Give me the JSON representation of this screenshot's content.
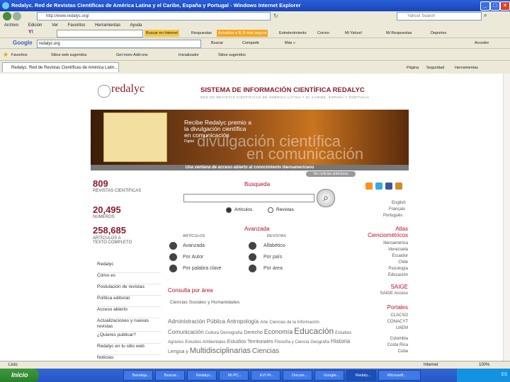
{
  "window": {
    "title": "Redalyc. Red de Revistas Científicas de América Latina y el Caribe, España y Portugal - Windows Internet Explorer",
    "controls": [
      "_",
      "□",
      "×"
    ]
  },
  "address_bar": {
    "url": "http://www.redalyc.org/",
    "search_placeholder": "Yahoo! Search"
  },
  "menu": [
    "Archivo",
    "Edición",
    "Ver",
    "Favoritos",
    "Herramientas",
    "Ayuda"
  ],
  "toolbar1": {
    "items": [
      "Buscar en Internet",
      "Respuestas",
      "Actualiza a IE 8 más segura",
      "Entretenimiento",
      "Correo",
      "Noticias",
      "Mi Yahoo!",
      "Mi Respuestas",
      "Deportes"
    ]
  },
  "google_bar": {
    "label": "Google",
    "query": "redalyc.org",
    "buttons": [
      "Buscar",
      "Compartir",
      "Más »"
    ],
    "right": "Acceder"
  },
  "favorites_bar": {
    "items": [
      "Favoritos",
      "Sitios web sugeridos",
      "Get more Add-ons",
      "Inicializador",
      "Sitios sugeridos"
    ],
    "tools": [
      "Página",
      "Seguridad",
      "Herramientas"
    ]
  },
  "tab": {
    "label": "Redalyc. Red de Revistas Científicas de América Latin..."
  },
  "site": {
    "logo": "redalyc",
    "title": "SISTEMA DE INFORMACIÓN CIENTÍFICA REDALYC",
    "subtitle": "RED DE REVISTAS CIENTÍFICAS DE AMÉRICA LATINA Y EL CARIBE, ESPAÑA Y PORTUGAL",
    "banner": {
      "headline_line1": "Recibe Redalyc premio a",
      "headline_line2": "la divulgación científica",
      "headline_line3": "en comunicación",
      "headline_line4": "Digital",
      "overlay_line1": "divulgación científica",
      "overlay_line2": "en comunicación",
      "slogan": "Una ventana de acceso abierto al conocimiento iberoamericano",
      "more_button": "Ver noticias anteriores"
    },
    "stats": [
      {
        "value": "809",
        "label": "REVISTAS CIENTÍFICAS"
      },
      {
        "value": "20,495",
        "label": "NÚMEROS"
      },
      {
        "value": "258,685",
        "label": "ARTÍCULOS A TEXTO COMPLETO"
      }
    ],
    "search": {
      "title": "Busqueda",
      "input_value": "",
      "option_articles": "Artículos",
      "option_journals": "Revistas"
    },
    "advanced": {
      "title": "Avanzada",
      "col_articles": "ARTÍCULOS",
      "col_journals": "REVISTAS",
      "articles": [
        "Avanzada",
        "Por Autor",
        "Por palabra clave"
      ],
      "journals": [
        "Alfabético",
        "Por país",
        "Por área"
      ]
    },
    "nav": [
      "Redalyc",
      "Cómo es",
      "Postulación de revistas",
      "Política editorial",
      "Acceso abierto",
      "Actualizaciones y nuevas revistas",
      "¿Quieres publicar?",
      "Redalyc en tu sitio web",
      "Noticias"
    ],
    "area": {
      "title": "Consulta por área",
      "category": "Ciencias Sociales y Humanidades",
      "cloud": [
        "Administración Pública",
        "Antropología",
        "Arte",
        "Ciencias de la Información",
        "Comunicación",
        "Cultura",
        "Demografía",
        "Derecho",
        "Economía",
        "Educación",
        "Estudios Agrarios",
        "Estudios Ambientales",
        "Estudios Territoriales",
        "Filosofía y Ciencia",
        "Geografía",
        "Historia",
        "Lengua y",
        "Multidisciplinarias",
        "Ciencias"
      ]
    },
    "languages": [
      "English",
      "Français",
      "Português"
    ],
    "atlas": {
      "title": "Atlas Cienciométricos",
      "items": [
        "Iberoamérica",
        "Venezuela",
        "Ecuador",
        "Chile",
        "Psicología",
        "Educación"
      ]
    },
    "saige": {
      "title": "SAIGE",
      "link": "SAIGE Acceso"
    },
    "portales": {
      "title": "Portales",
      "items": [
        "CLACSO",
        "CONACYT",
        "UAEM",
        "Colombia",
        "Costa Rica",
        "Cuba"
      ]
    }
  },
  "status_bar": {
    "left": "Listo",
    "zone": "Internet",
    "zoom": "100%"
  },
  "taskbar": {
    "start": "Inicio",
    "tasks": [
      "Bandeja...",
      "Buscar...",
      "Redalyc...",
      "Mi PC...",
      "EVI Pr...",
      "Docum...",
      "Google...",
      "Redaly...",
      "Microsoft..."
    ],
    "clock": "ES"
  },
  "colors": {
    "brand_red": "#b3102a",
    "maroon": "#8a1c2b",
    "xp_blue": "#2456c5"
  }
}
